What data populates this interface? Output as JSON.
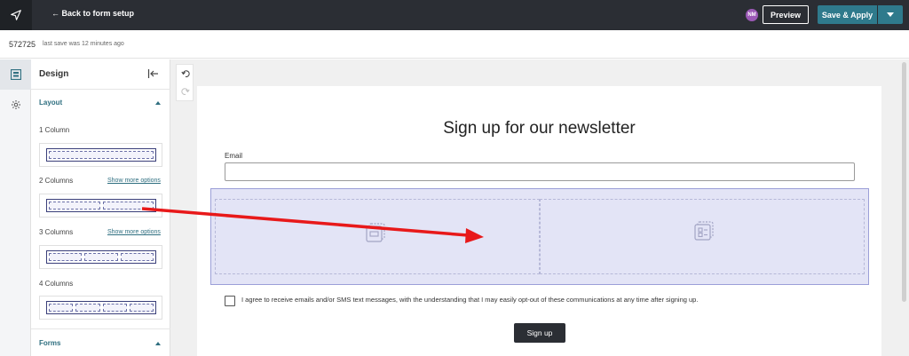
{
  "topbar": {
    "back_label": "← Back to form setup",
    "avatar_initials": "NM",
    "preview_label": "Preview",
    "save_label": "Save & Apply"
  },
  "subbar": {
    "form_id": "572725",
    "save_status": "last save was 12 minutes ago"
  },
  "rail": {
    "items": [
      {
        "icon": "design-icon",
        "active": true
      },
      {
        "icon": "gear-icon",
        "active": false
      }
    ]
  },
  "panel": {
    "title": "Design",
    "layout_section": "Layout",
    "forms_section": "Forms",
    "options": [
      {
        "label": "1 Column",
        "columns": 1,
        "more": ""
      },
      {
        "label": "2 Columns",
        "columns": 2,
        "more": "Show more options"
      },
      {
        "label": "3 Columns",
        "columns": 3,
        "more": "Show more options"
      },
      {
        "label": "4 Columns",
        "columns": 4,
        "more": ""
      }
    ]
  },
  "history": {
    "undo_icon": "undo-icon",
    "redo_icon": "redo-icon"
  },
  "form": {
    "title": "Sign up for our newsletter",
    "email_label": "Email",
    "email_value": "",
    "consent_text": "I agree to receive emails and/or SMS text messages, with the understanding that I may easily opt-out of these communications at any time after signing up.",
    "signup_label": "Sign up"
  },
  "colors": {
    "topbar": "#2b2e34",
    "accent": "#2f7a8c",
    "drop_zone": "#e3e4f6",
    "annotation_arrow": "#e8191a"
  }
}
